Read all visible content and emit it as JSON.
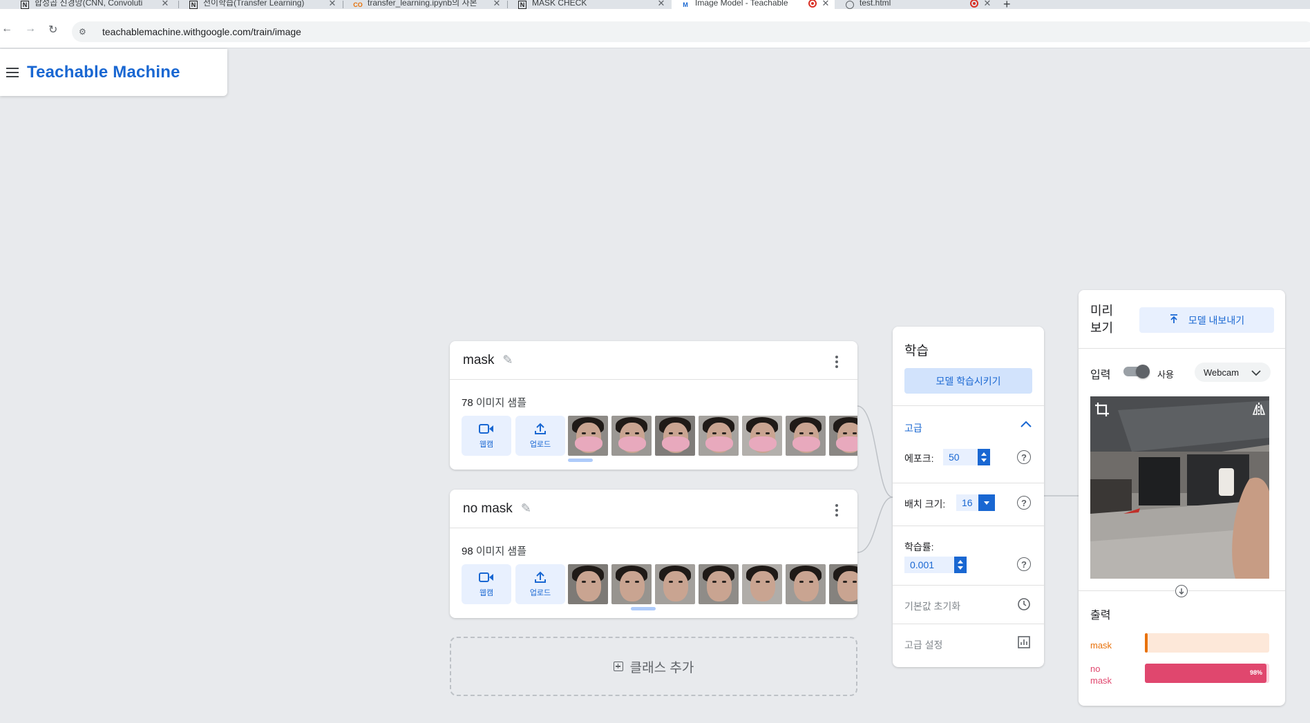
{
  "browser": {
    "tabs": [
      {
        "title": "합성곱 신경망(CNN, Convoluti",
        "favicon": "N"
      },
      {
        "title": "전이학습(Transfer Learning)",
        "favicon": "N"
      },
      {
        "title": "transfer_learning.ipynb의 사본",
        "favicon": "CO"
      },
      {
        "title": "MASK CHECK",
        "favicon": "N"
      },
      {
        "title": "Image Model - Teachable",
        "favicon": "M"
      },
      {
        "title": "test.html",
        "favicon": "globe"
      }
    ],
    "url": "teachablemachine.withgoogle.com/train/image"
  },
  "app": {
    "title": "Teachable Machine"
  },
  "classes": [
    {
      "name": "mask",
      "sample_count": "78",
      "sample_label": "이미지 샘플",
      "webcam_label": "웹캠",
      "upload_label": "업로드"
    },
    {
      "name": "no mask",
      "sample_count": "98",
      "sample_label": "이미지 샘플",
      "webcam_label": "웹캠",
      "upload_label": "업로드"
    }
  ],
  "add_class_label": "클래스 추가",
  "training": {
    "title": "학습",
    "train_button": "모델 학습시키기",
    "advanced_label": "고급",
    "epochs_label": "에포크:",
    "epochs_value": "50",
    "batch_label": "배치 크기:",
    "batch_value": "16",
    "lr_label": "학습률:",
    "lr_value": "0.001",
    "reset_label": "기본값 초기화",
    "advanced_settings_label": "고급 설정"
  },
  "preview": {
    "title": "미리 보기",
    "export_button": "모델 내보내기",
    "input_label": "입력",
    "toggle_label": "사용",
    "camera_select": "Webcam",
    "output_label": "출력",
    "outputs": [
      {
        "label": "mask",
        "confidence": 0.02,
        "color": "#e8710a",
        "track_color": "#fde8d9",
        "display": ""
      },
      {
        "label": "no mask",
        "confidence": 0.98,
        "color": "#e0476e",
        "track_color": "#fbd5df",
        "display": "98%"
      }
    ]
  },
  "colors": {
    "accent": "#1967d2",
    "accent_light": "#e8f0fe",
    "background": "#e8eaed"
  }
}
